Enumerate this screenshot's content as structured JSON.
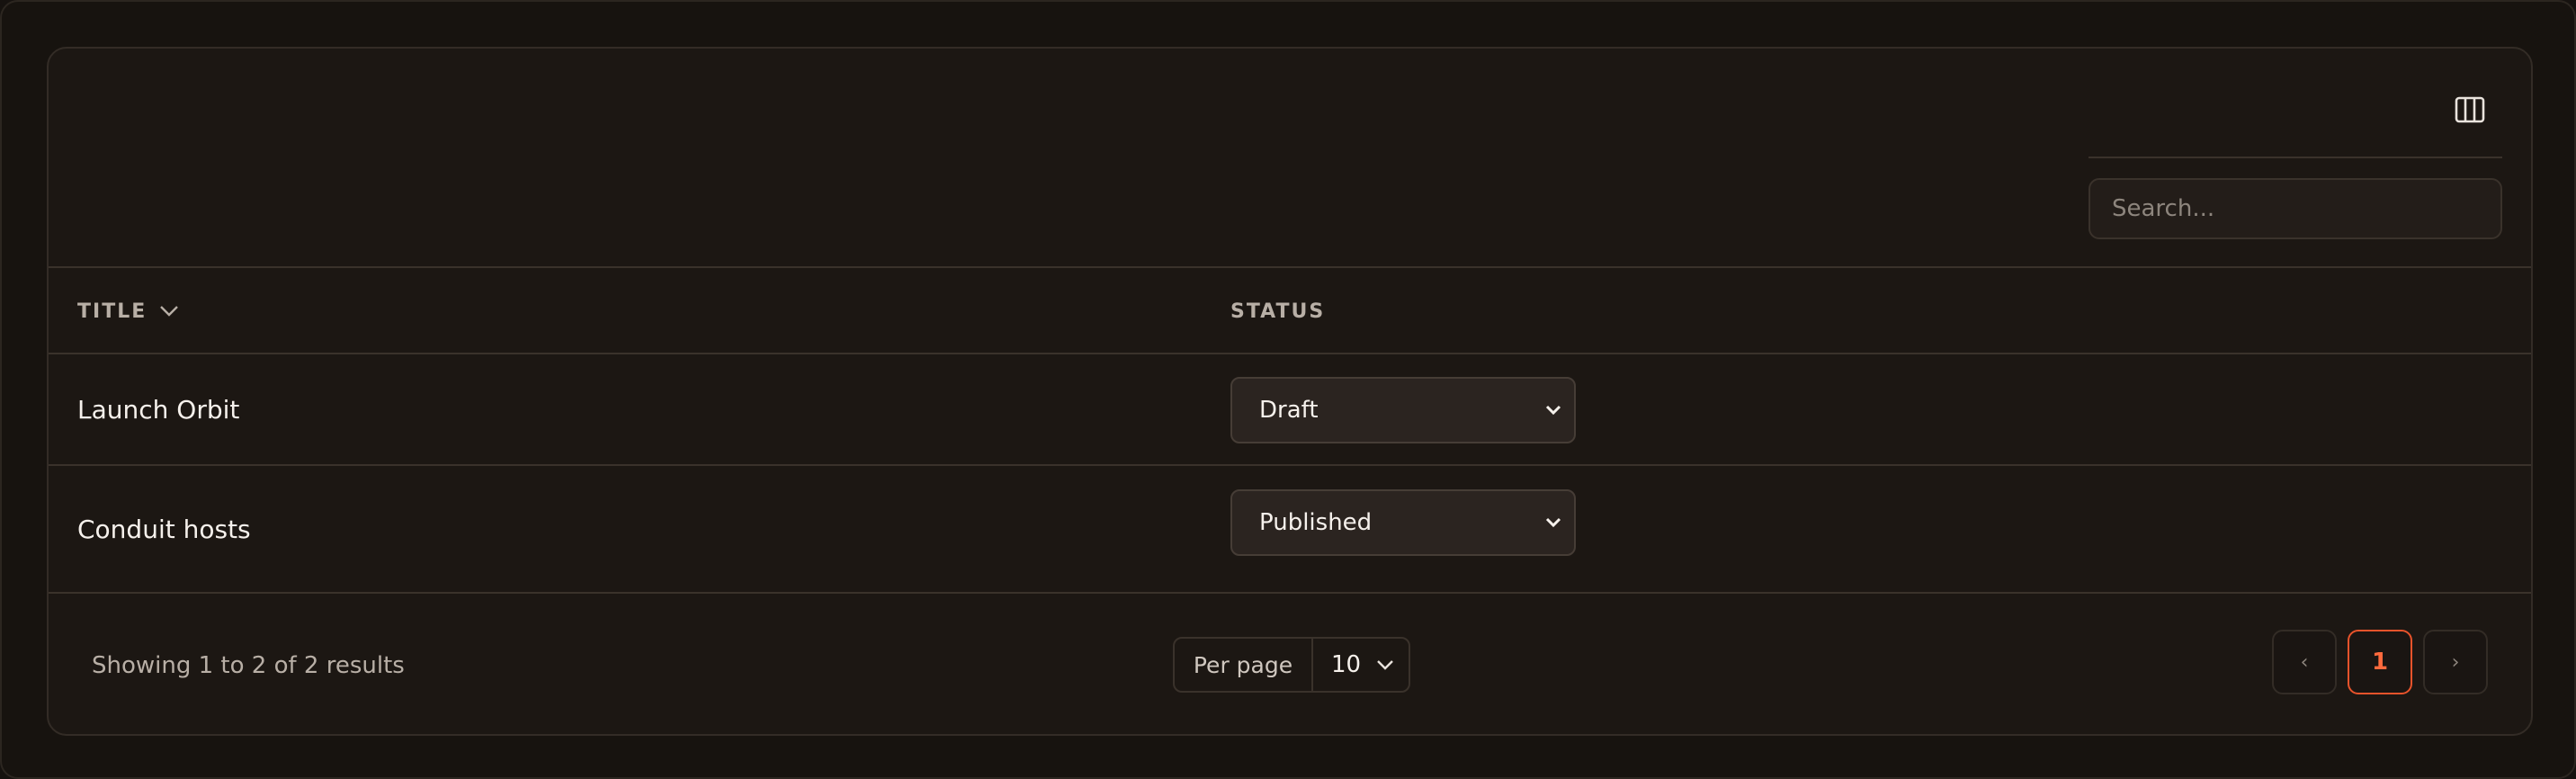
{
  "toolbar": {
    "columns_icon": "columns-icon",
    "search_placeholder": "Search..."
  },
  "table": {
    "headers": {
      "title": "TITLE",
      "status": "STATUS"
    },
    "rows": [
      {
        "title": "Launch Orbit",
        "status": "Draft"
      },
      {
        "title": "Conduit hosts",
        "status": "Published"
      }
    ]
  },
  "footer": {
    "results": "Showing 1 to 2 of 2 results",
    "per_page_label": "Per page",
    "per_page_value": "10",
    "pagination": {
      "prev": "‹",
      "current": "1",
      "next": "›"
    }
  },
  "colors": {
    "background": "#1c1713",
    "border": "#3a322b",
    "accent": "#e8532b"
  }
}
